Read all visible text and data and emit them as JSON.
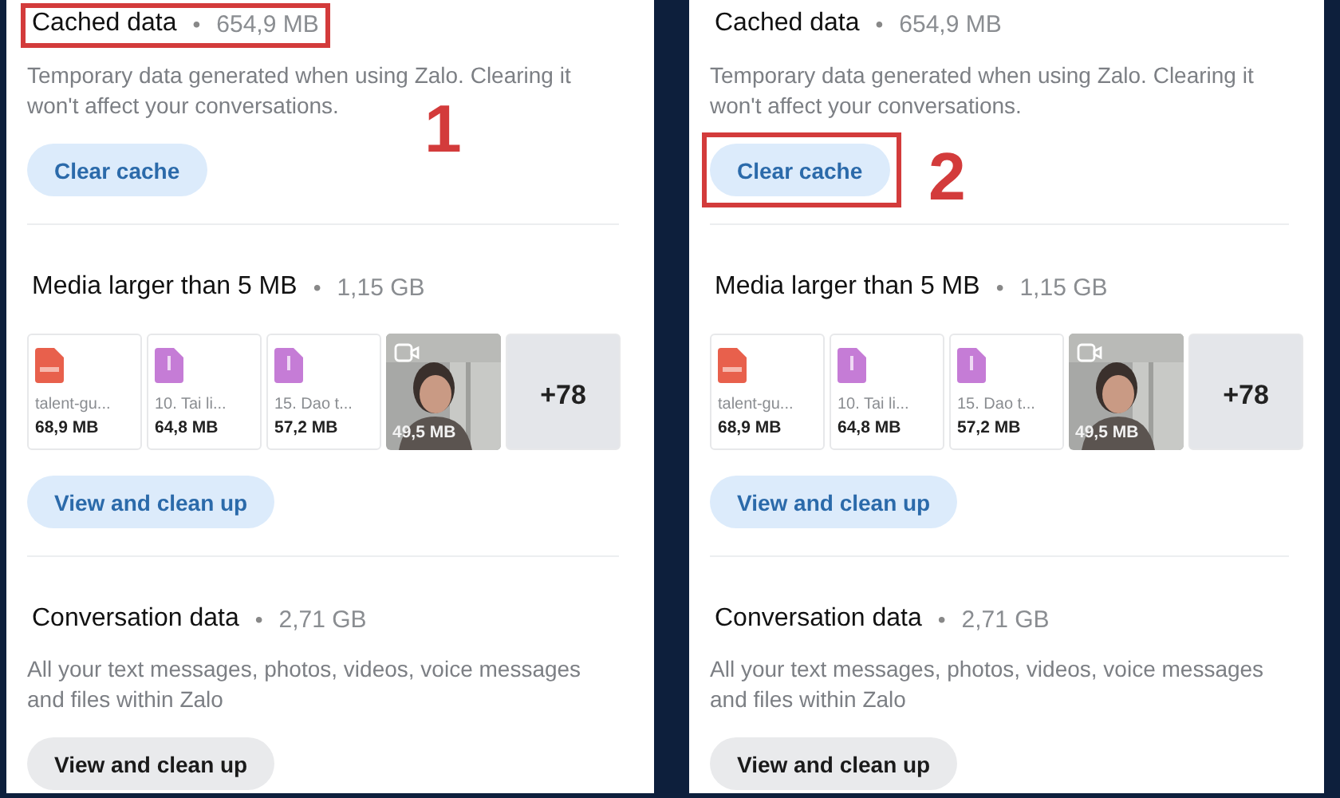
{
  "panels": [
    {
      "step": "1",
      "cache": {
        "title": "Cached data",
        "separator": "•",
        "size": "654,9 MB",
        "title_highlighted": true,
        "description": "Temporary data generated when using Zalo. Clearing it won't affect your conversations.",
        "button": "Clear cache",
        "button_highlighted": false
      },
      "media": {
        "title": "Media larger than 5 MB",
        "separator": "•",
        "size": "1,15 GB",
        "tiles": [
          {
            "kind": "pdf",
            "name": "talent-gu...",
            "size": "68,9 MB"
          },
          {
            "kind": "doc",
            "name": "10. Tai li...",
            "size": "64,8 MB"
          },
          {
            "kind": "doc",
            "name": "15. Dao t...",
            "size": "57,2 MB"
          },
          {
            "kind": "video",
            "size": "49,5 MB"
          },
          {
            "kind": "more",
            "count": "+78"
          }
        ],
        "button": "View and clean up"
      },
      "conversation": {
        "title": "Conversation data",
        "separator": "•",
        "size": "2,71 GB",
        "description": "All your text messages, photos, videos, voice messages and files within Zalo",
        "button": "View and clean up"
      }
    },
    {
      "step": "2",
      "cache": {
        "title": "Cached data",
        "separator": "•",
        "size": "654,9 MB",
        "title_highlighted": false,
        "description": "Temporary data generated when using Zalo. Clearing it won't affect your conversations.",
        "button": "Clear cache",
        "button_highlighted": true
      },
      "media": {
        "title": "Media larger than 5 MB",
        "separator": "•",
        "size": "1,15 GB",
        "tiles": [
          {
            "kind": "pdf",
            "name": "talent-gu...",
            "size": "68,9 MB"
          },
          {
            "kind": "doc",
            "name": "10. Tai li...",
            "size": "64,8 MB"
          },
          {
            "kind": "doc",
            "name": "15. Dao t...",
            "size": "57,2 MB"
          },
          {
            "kind": "video",
            "size": "49,5 MB"
          },
          {
            "kind": "more",
            "count": "+78"
          }
        ],
        "button": "View and clean up"
      },
      "conversation": {
        "title": "Conversation data",
        "separator": "•",
        "size": "2,71 GB",
        "description": "All your text messages, photos, videos, voice messages and files within Zalo",
        "button": "View and clean up"
      }
    }
  ]
}
